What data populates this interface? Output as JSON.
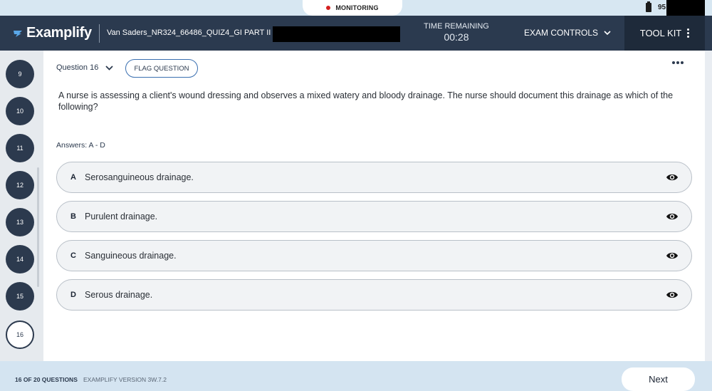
{
  "status_bar": {
    "monitoring_label": "MONITORING",
    "battery_percent": "95"
  },
  "header": {
    "app_name": "Examplify",
    "exam_title": "Van Saders_NR324_66486_QUIZ4_GI PART II",
    "time_remaining_label": "TIME REMAINING",
    "time_remaining_value": "00:28",
    "exam_controls_label": "EXAM CONTROLS",
    "toolkit_label": "TOOL KIT"
  },
  "sidebar": {
    "questions": [
      "9",
      "10",
      "11",
      "12",
      "13",
      "14",
      "15",
      "16"
    ],
    "current": "16"
  },
  "question": {
    "label": "Question 16",
    "flag_label": "FLAG QUESTION",
    "text": "A nurse is assessing a client's wound dressing and observes a mixed watery and bloody drainage. The nurse should document this drainage as which of the following?",
    "answers_label": "Answers: A - D",
    "answers": [
      {
        "letter": "A",
        "text": "Serosanguineous drainage."
      },
      {
        "letter": "B",
        "text": "Purulent drainage."
      },
      {
        "letter": "C",
        "text": "Sanguineous drainage."
      },
      {
        "letter": "D",
        "text": "Serous drainage."
      }
    ]
  },
  "footer": {
    "progress": "16 OF 20 QUESTIONS",
    "version": "EXAMPLIFY VERSION 3W.7.2",
    "next_label": "Next"
  },
  "colors": {
    "header_bg": "#2b3a4f",
    "toolkit_bg": "#1e2a3a",
    "nav_circle": "#2c3a4e",
    "flag_border": "#3a6fb0",
    "footer_bg": "#d4e4f1",
    "record_dot": "#d42020"
  }
}
